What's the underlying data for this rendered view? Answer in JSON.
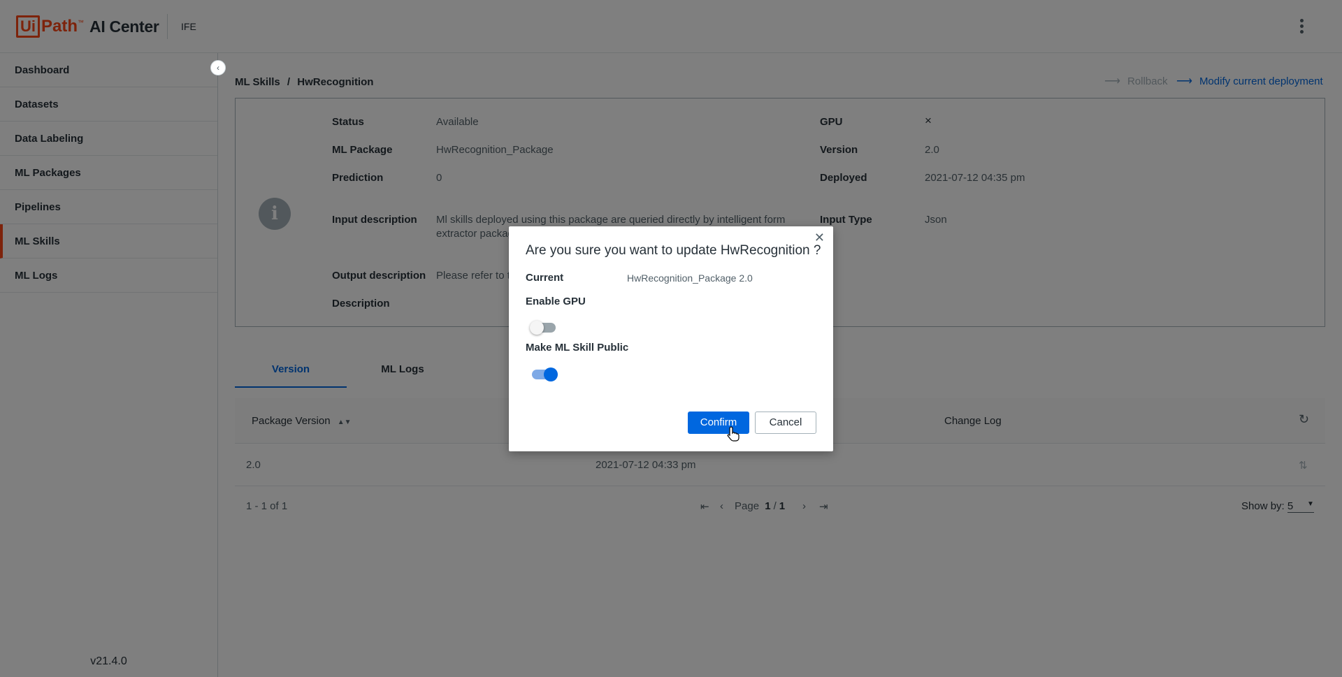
{
  "header": {
    "logo_ui": "Ui",
    "logo_path": "Path",
    "logo_tm": "™",
    "product": "AI Center",
    "tenant": "IFE"
  },
  "sidebar": {
    "items": [
      {
        "label": "Dashboard"
      },
      {
        "label": "Datasets"
      },
      {
        "label": "Data Labeling"
      },
      {
        "label": "ML Packages"
      },
      {
        "label": "Pipelines"
      },
      {
        "label": "ML Skills",
        "active": true
      },
      {
        "label": "ML Logs"
      }
    ],
    "collapse_glyph": "‹",
    "version": "v21.4.0"
  },
  "breadcrumb": {
    "root": "ML Skills",
    "separator": "/",
    "current": "HwRecognition"
  },
  "actions": {
    "rollback": "Rollback",
    "modify": "Modify current deployment",
    "arrow": "⟶"
  },
  "details": {
    "status_label": "Status",
    "status_value": "Available",
    "package_label": "ML Package",
    "package_value": "HwRecognition_Package",
    "prediction_label": "Prediction",
    "prediction_value": "0",
    "input_desc_label": "Input description",
    "input_desc_value": "Ml skills deployed using this package are queried directly by intelligent form extractor package supported and c",
    "output_desc_label": "Output description",
    "output_desc_value": "Please refer to th",
    "description_label": "Description",
    "gpu_label": "GPU",
    "gpu_value": "×",
    "version_label": "Version",
    "version_value": "2.0",
    "deployed_label": "Deployed",
    "deployed_value": "2021-07-12 04:35 pm",
    "input_type_label": "Input Type",
    "input_type_value": "Json",
    "info_glyph": "i"
  },
  "tabs": [
    {
      "label": "Version",
      "active": true
    },
    {
      "label": "ML Logs",
      "active": false
    }
  ],
  "table": {
    "columns": {
      "package_version": "Package Version",
      "change_log": "Change Log"
    },
    "rows": [
      {
        "package_version": "2.0",
        "date": "2021-07-12 04:33 pm"
      }
    ],
    "range": "1 - 1 of 1",
    "page_label": "Page",
    "page_current": "1",
    "page_sep": "/",
    "page_total": "1",
    "show_by_label": "Show by:",
    "show_by_value": "5"
  },
  "modal": {
    "title": "Are you sure you want to update HwRecognition ?",
    "current_label": "Current",
    "current_value": "HwRecognition_Package 2.0",
    "gpu_label": "Enable GPU",
    "gpu_enabled": false,
    "public_label": "Make ML Skill Public",
    "public_enabled": true,
    "confirm": "Confirm",
    "cancel": "Cancel"
  },
  "colors": {
    "brand": "#fa4616",
    "primary": "#0067df",
    "text": "#273139",
    "muted": "#526069"
  }
}
